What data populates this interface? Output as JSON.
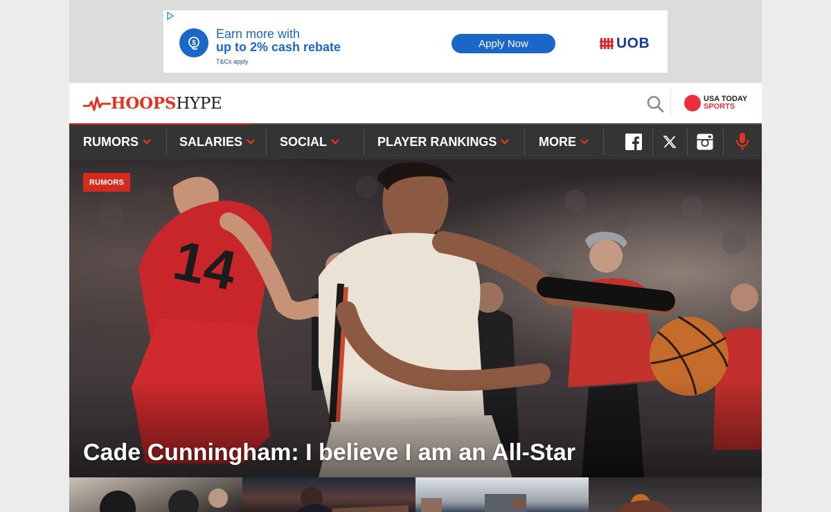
{
  "ad": {
    "line1": "Earn more with",
    "line2": "up to 2% cash rebate",
    "terms": "T&Cs apply",
    "cta": "Apply Now",
    "brand": "UOB"
  },
  "header": {
    "logo_part1": "HOOPS",
    "logo_part2": "HYPE",
    "partner_line1": "USA TODAY",
    "partner_line2": "SPORTS"
  },
  "nav": {
    "items": [
      {
        "label": "RUMORS"
      },
      {
        "label": "SALARIES"
      },
      {
        "label": "SOCIAL"
      },
      {
        "label": "PLAYER RANKINGS"
      },
      {
        "label": "MORE"
      }
    ],
    "social": [
      "facebook-icon",
      "x-icon",
      "instagram-icon",
      "microphone-icon"
    ]
  },
  "hero": {
    "category": "RUMORS",
    "headline": "Cade Cunningham: I believe I am an All-Star"
  },
  "colors": {
    "brand_red": "#e03421",
    "nav_bg": "#343434",
    "ad_blue": "#1b66c9"
  }
}
